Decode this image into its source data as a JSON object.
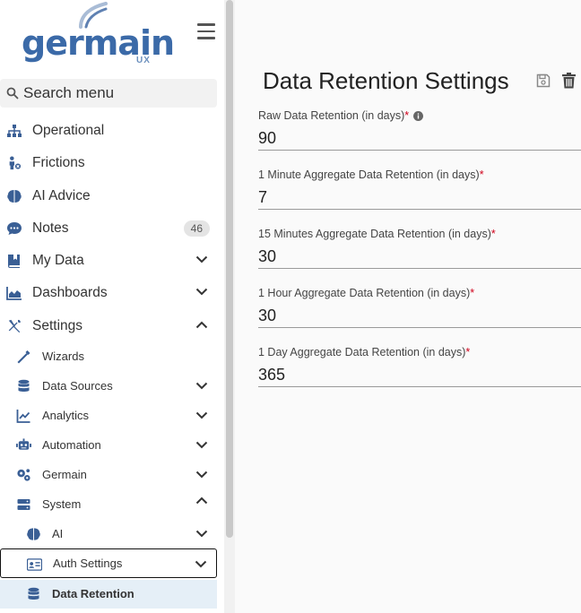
{
  "brand": {
    "name": "germain",
    "sub": "UX"
  },
  "search": {
    "placeholder": "Search menu"
  },
  "nav": {
    "operational": "Operational",
    "frictions": "Frictions",
    "ai_advice": "AI Advice",
    "notes": "Notes",
    "notes_count": "46",
    "my_data": "My Data",
    "dashboards": "Dashboards",
    "settings": "Settings"
  },
  "settings_sub": {
    "wizards": "Wizards",
    "data_sources": "Data Sources",
    "analytics": "Analytics",
    "automation": "Automation",
    "germain": "Germain",
    "system": "System"
  },
  "system_sub": {
    "ai": "AI",
    "auth_settings": "Auth Settings",
    "data_retention": "Data Retention"
  },
  "page": {
    "title": "Data Retention Settings",
    "fields": [
      {
        "label": "Raw Data Retention (in days)",
        "value": "90"
      },
      {
        "label": "1 Minute Aggregate Data Retention (in days)",
        "value": "7"
      },
      {
        "label": "15 Minutes Aggregate Data Retention (in days)",
        "value": "30"
      },
      {
        "label": "1 Hour Aggregate Data Retention (in days)",
        "value": "30"
      },
      {
        "label": "1 Day Aggregate Data Retention (in days)",
        "value": "365"
      }
    ],
    "required_mark": "*"
  },
  "colors": {
    "brand": "#3b6aa8",
    "accent": "#3a5f95",
    "required": "#d0021b",
    "selected_bg": "#e5eff7"
  }
}
